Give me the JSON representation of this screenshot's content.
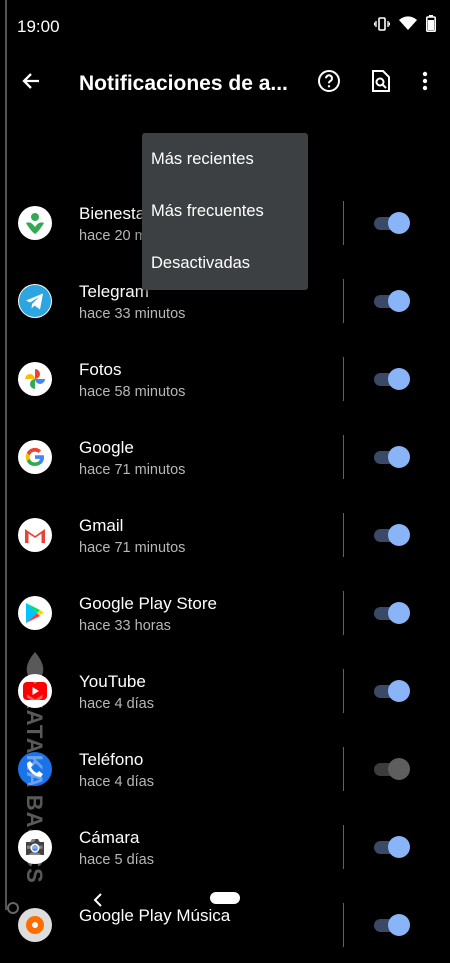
{
  "status_bar": {
    "time": "19:00",
    "icons": [
      "vibrate-icon",
      "wifi-icon",
      "battery-icon"
    ]
  },
  "app_bar": {
    "title": "Notificaciones de a...",
    "icons": [
      "back-arrow-icon",
      "help-icon",
      "search-in-page-icon",
      "more-vert-icon"
    ]
  },
  "colors": {
    "toggle_on": "#8ab4f8",
    "toggle_off": "#5e5e5e",
    "menu_bg": "#3c4043"
  },
  "dropdown_menu": {
    "items": [
      {
        "label": "Más recientes"
      },
      {
        "label": "Más frecuentes"
      },
      {
        "label": "Desactivadas"
      }
    ]
  },
  "apps": [
    {
      "name": "Bienesta",
      "time": "hace 20 m",
      "icon": "wellbeing-icon",
      "enabled": true
    },
    {
      "name": "Telegram",
      "time": "hace 33 minutos",
      "icon": "telegram-icon",
      "enabled": true
    },
    {
      "name": "Fotos",
      "time": "hace 58 minutos",
      "icon": "photos-icon",
      "enabled": true
    },
    {
      "name": "Google",
      "time": "hace 71 minutos",
      "icon": "google-icon",
      "enabled": true
    },
    {
      "name": "Gmail",
      "time": "hace 71 minutos",
      "icon": "gmail-icon",
      "enabled": true
    },
    {
      "name": "Google Play Store",
      "time": "hace 33 horas",
      "icon": "play-store-icon",
      "enabled": true
    },
    {
      "name": "YouTube",
      "time": "hace 4 días",
      "icon": "youtube-icon",
      "enabled": true
    },
    {
      "name": "Teléfono",
      "time": "hace 4 días",
      "icon": "phone-icon",
      "enabled": false
    },
    {
      "name": "Cámara",
      "time": "hace 5 días",
      "icon": "camera-icon",
      "enabled": true
    },
    {
      "name": "Google Play Música",
      "time": "",
      "icon": "play-music-icon",
      "enabled": true
    }
  ],
  "watermark_text": "XATAKA BASICS"
}
